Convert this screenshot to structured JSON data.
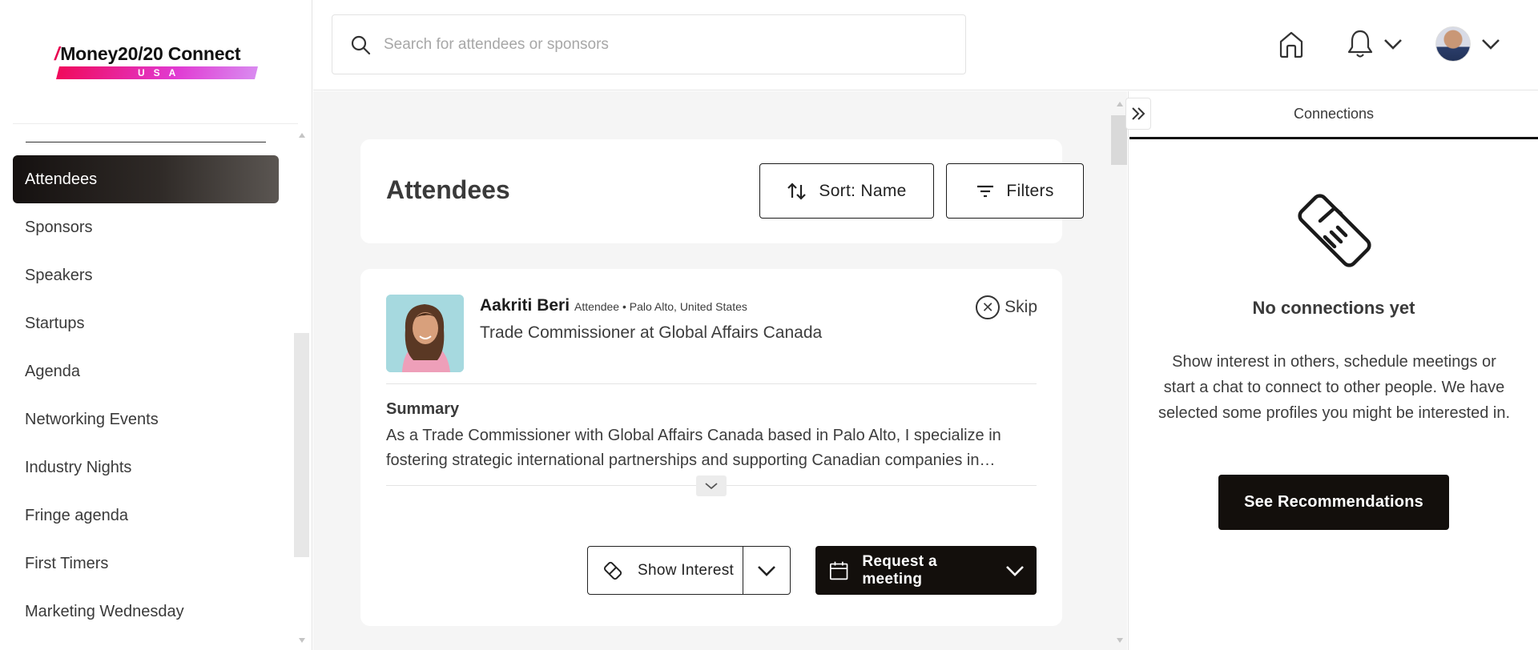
{
  "brand": {
    "logo_text": "Money20/20 Connect",
    "logo_sub": "USA",
    "accent_gradient": [
      "#f00a5c",
      "#e13bd3",
      "#d98af0"
    ]
  },
  "search": {
    "placeholder": "Search for attendees or sponsors",
    "value": ""
  },
  "header": {
    "icons": [
      "home-icon",
      "bell-icon",
      "chevron-down-icon",
      "avatar",
      "chevron-down-icon"
    ]
  },
  "sidebar": {
    "active": "Attendees",
    "items": [
      {
        "label": "Attendees"
      },
      {
        "label": "Sponsors"
      },
      {
        "label": "Speakers"
      },
      {
        "label": "Startups"
      },
      {
        "label": "Agenda"
      },
      {
        "label": "Networking Events"
      },
      {
        "label": "Industry Nights"
      },
      {
        "label": "Fringe agenda"
      },
      {
        "label": "First Timers"
      },
      {
        "label": "Marketing Wednesday"
      }
    ]
  },
  "main": {
    "title": "Attendees",
    "sort_label": "Sort: Name",
    "filters_label": "Filters",
    "attendee": {
      "name": "Aakriti Beri",
      "meta": "Attendee • Palo Alto, United States",
      "job": "Trade Commissioner at Global Affairs Canada",
      "skip_label": "Skip",
      "summary_label": "Summary",
      "summary": "As a Trade Commissioner with Global Affairs Canada based in Palo Alto, I specialize in fostering strategic international partnerships and supporting Canadian companies in…",
      "show_interest_label": "Show Interest",
      "request_meeting_label": "Request a meeting"
    }
  },
  "connections": {
    "tab_label": "Connections",
    "empty_title": "No connections yet",
    "empty_text": "Show interest in others, schedule meetings or start a chat to connect to other people. We have selected some profiles you might be interested in.",
    "cta_label": "See Recommendations"
  },
  "colors": {
    "dark": "#130f0c",
    "background": "#f5f5f5",
    "active_nav": "#151110"
  }
}
